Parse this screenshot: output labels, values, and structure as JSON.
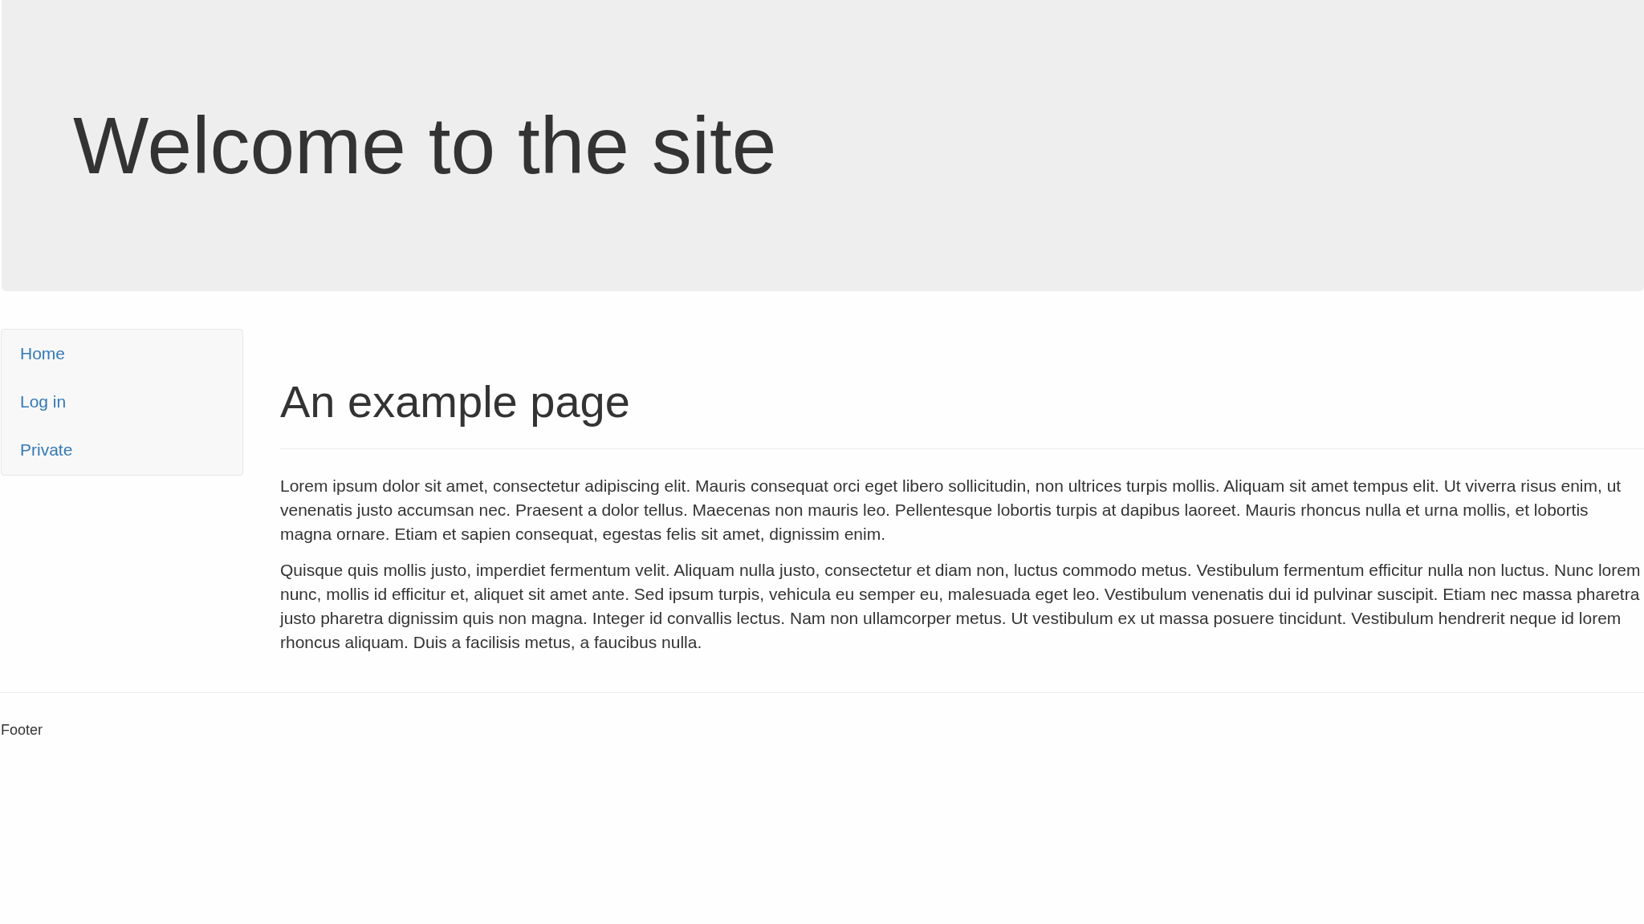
{
  "header": {
    "title": "Welcome to the site"
  },
  "nav": {
    "items": [
      {
        "label": "Home"
      },
      {
        "label": "Log in"
      },
      {
        "label": "Private"
      }
    ]
  },
  "main": {
    "heading": "An example page",
    "paragraphs": [
      "Lorem ipsum dolor sit amet, consectetur adipiscing elit. Mauris consequat orci eget libero sollicitudin, non ultrices turpis mollis. Aliquam sit amet tempus elit. Ut viverra risus enim, ut venenatis justo accumsan nec. Praesent a dolor tellus. Maecenas non mauris leo. Pellentesque lobortis turpis at dapibus laoreet. Mauris rhoncus nulla et urna mollis, et lobortis magna ornare. Etiam et sapien consequat, egestas felis sit amet, dignissim enim.",
      "Quisque quis mollis justo, imperdiet fermentum velit. Aliquam nulla justo, consectetur et diam non, luctus commodo metus. Vestibulum fermentum efficitur nulla non luctus. Nunc lorem nunc, mollis id efficitur et, aliquet sit amet ante. Sed ipsum turpis, vehicula eu semper eu, malesuada eget leo. Vestibulum venenatis dui id pulvinar suscipit. Etiam nec massa pharetra justo pharetra dignissim quis non magna. Integer id convallis lectus. Nam non ullamcorper metus. Ut vestibulum ex ut massa posuere tincidunt. Vestibulum hendrerit neque id lorem rhoncus aliquam. Duis a facilisis metus, a faucibus nulla."
    ]
  },
  "footer": {
    "text": "Footer"
  }
}
